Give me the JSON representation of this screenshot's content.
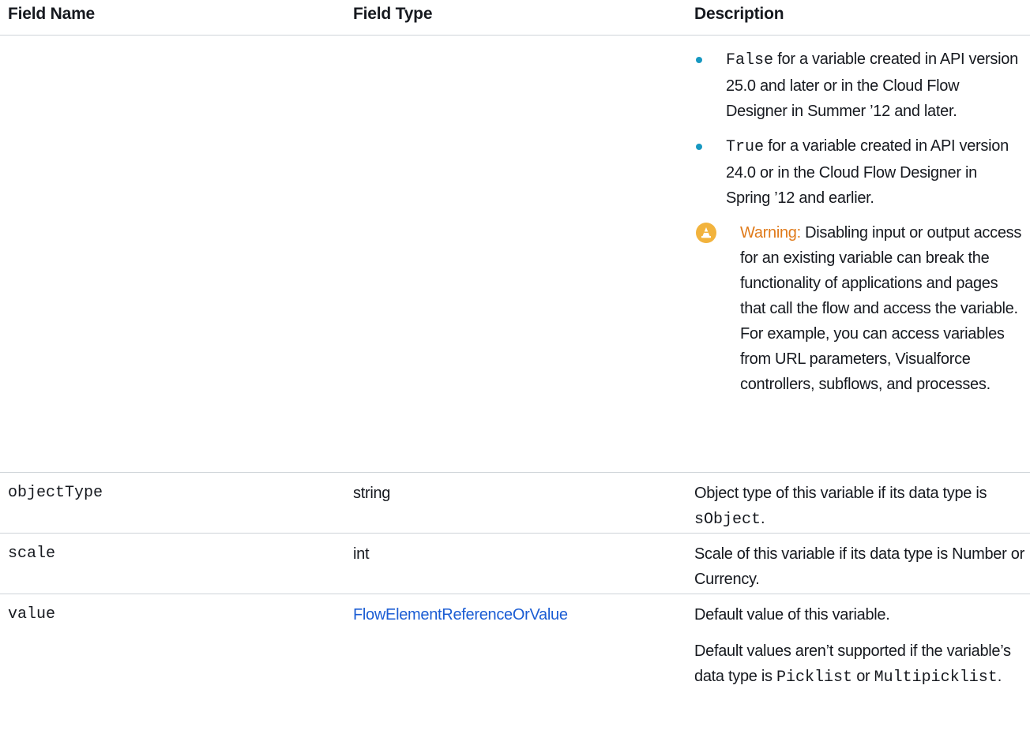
{
  "columns": {
    "field_name": "Field Name",
    "field_type": "Field Type",
    "description": "Description"
  },
  "continued_row": {
    "bullets": [
      {
        "code": "False",
        "text": " for a variable created in API version 25.0 and later or in the Cloud Flow Designer in Summer ’12 and later."
      },
      {
        "code": "True",
        "text": " for a variable created in API version 24.0 or in the Cloud Flow Designer in Spring ’12 and earlier."
      }
    ],
    "warning": {
      "label": "Warning:",
      "text": " Disabling input or output access for an existing variable can break the functionality of applications and pages that call the flow and access the variable. For example, you can access variables from URL parameters, Visualforce controllers, subflows, and processes."
    }
  },
  "rows": [
    {
      "name": "objectType",
      "type": "string",
      "desc_pre": "Object type of this variable if its data type is ",
      "desc_code": "sObject",
      "desc_post": "."
    },
    {
      "name": "scale",
      "type": "int",
      "desc": "Scale of this variable if its data type is Number or Currency."
    },
    {
      "name": "value",
      "type": "FlowElementReferenceOrValue",
      "desc": "Default value of this variable.",
      "desc2_pre": "Default values aren’t supported if the variable’s data type is ",
      "desc2_code1": "Picklist",
      "desc2_mid": " or ",
      "desc2_code2": "Multipicklist",
      "desc2_post": "."
    }
  ],
  "colors": {
    "link": "#1b5dd4",
    "bullet": "#1798c1",
    "warning_label": "#e07b1b",
    "warning_icon": "#f2b33d",
    "divider": "#cfd4d9"
  },
  "icons": {
    "bullet": "bullet-dot-icon",
    "warning": "warning-cone-icon"
  }
}
